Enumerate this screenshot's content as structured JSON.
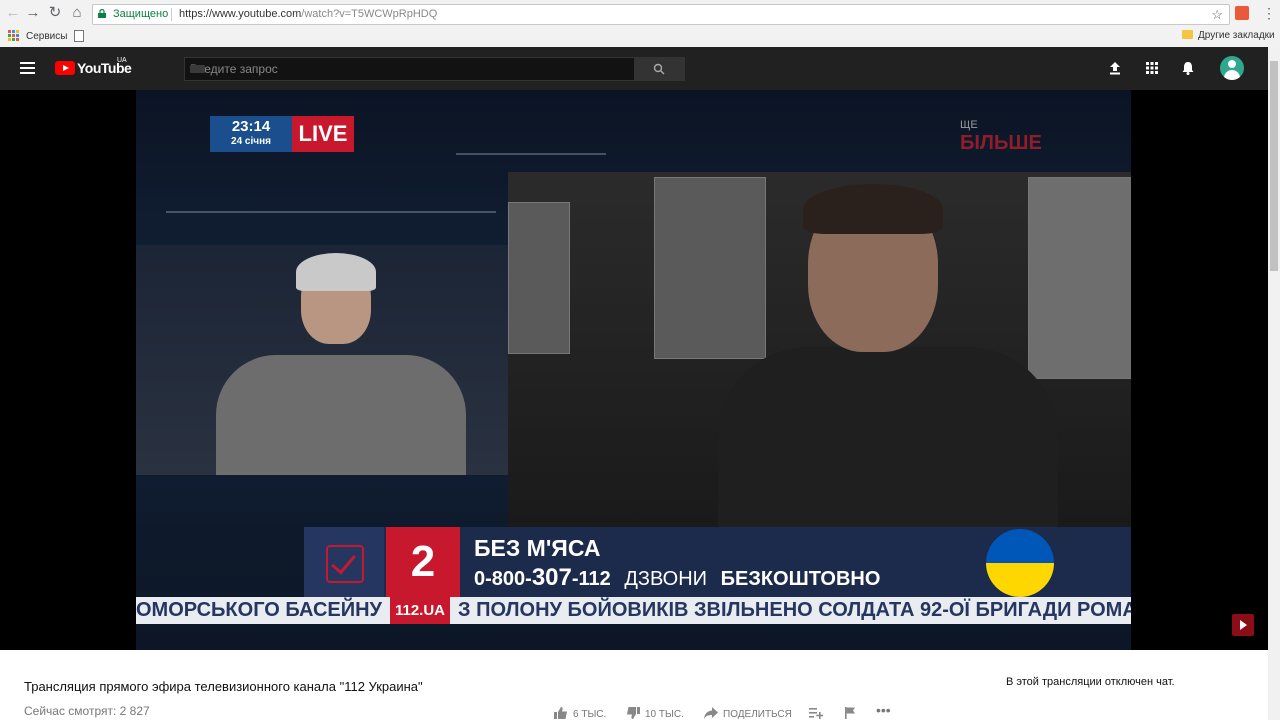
{
  "browser": {
    "secure_label": "Защищено",
    "url_host": "https://www.youtube.com",
    "url_path": "/watch?v=T5WCWpRpHDQ",
    "bookmarks": {
      "apps_label": "Сервисы",
      "other_label": "Другие закладки"
    }
  },
  "youtube": {
    "logo_text": "YouTube",
    "region": "UA",
    "search_placeholder": "Введите запрос"
  },
  "video": {
    "clock_time": "23:14",
    "clock_date": "24 січня",
    "live_label": "LIVE",
    "brand_top": "ЩЕ",
    "brand_main": "БІЛЬШЕ",
    "lower_third": {
      "number": "2",
      "title": "БЕЗ М'ЯСА",
      "phone_prefix": "0-800-",
      "phone_main": "307",
      "phone_suffix": "-112",
      "calls_label": "ДЗВОНИ",
      "free_label": "БЕЗКОШТОВНО"
    },
    "ticker": {
      "left_text": "ОМОРСЬКОГО БАСЕЙНУ",
      "logo": "112.UA",
      "right_text": "З ПОЛОНУ БОЙОВИКІВ ЗВІЛЬНЕНО СОЛДАТА 92-ОЇ БРИГАДИ РОМА"
    }
  },
  "details": {
    "title": "Трансляция прямого эфира телевизионного канала \"112 Украина\"",
    "viewers": "Сейчас смотрят: 2 827",
    "likes": "6 ТЫС.",
    "dislikes": "10 ТЫС.",
    "share_label": "ПОДЕЛИТЬСЯ",
    "chat_disabled": "В этой трансляции отключен чат."
  }
}
